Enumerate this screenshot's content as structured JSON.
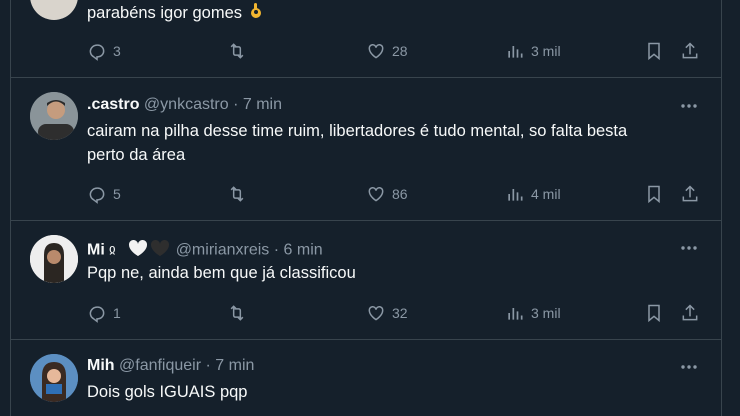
{
  "tweets": [
    {
      "text": "parabéns igor gomes",
      "replies": "3",
      "retweets": "",
      "likes": "28",
      "views": "3 mil"
    },
    {
      "name": ".castro",
      "handle": "@ynkcastro",
      "dot": "·",
      "time": "7 min",
      "text_line1": "cairam na pilha desse time ruim, libertadores é tudo mental, so falta besta",
      "text_line2": "perto da área",
      "replies": "5",
      "retweets": "",
      "likes": "86",
      "views": "4 mil"
    },
    {
      "name": "Mi",
      "handle": "@mirianxreis",
      "dot": "·",
      "time": "6 min",
      "text": "Pqp ne, ainda bem que já classificou",
      "replies": "1",
      "retweets": "",
      "likes": "32",
      "views": "3 mil"
    },
    {
      "name": "Mih",
      "handle": "@fanfiqueir",
      "dot": "·",
      "time": "7 min",
      "text": "Dois gols IGUAIS pqp"
    }
  ],
  "colors": {
    "background": "#15202b",
    "border": "#38444d",
    "muted": "#8b98a5",
    "text": "#f7f9f9"
  },
  "icons": [
    "reply-icon",
    "retweet-icon",
    "like-icon",
    "views-icon",
    "bookmark-icon",
    "share-icon",
    "more-icon",
    "ok-hand-emoji",
    "heart-emoji"
  ]
}
